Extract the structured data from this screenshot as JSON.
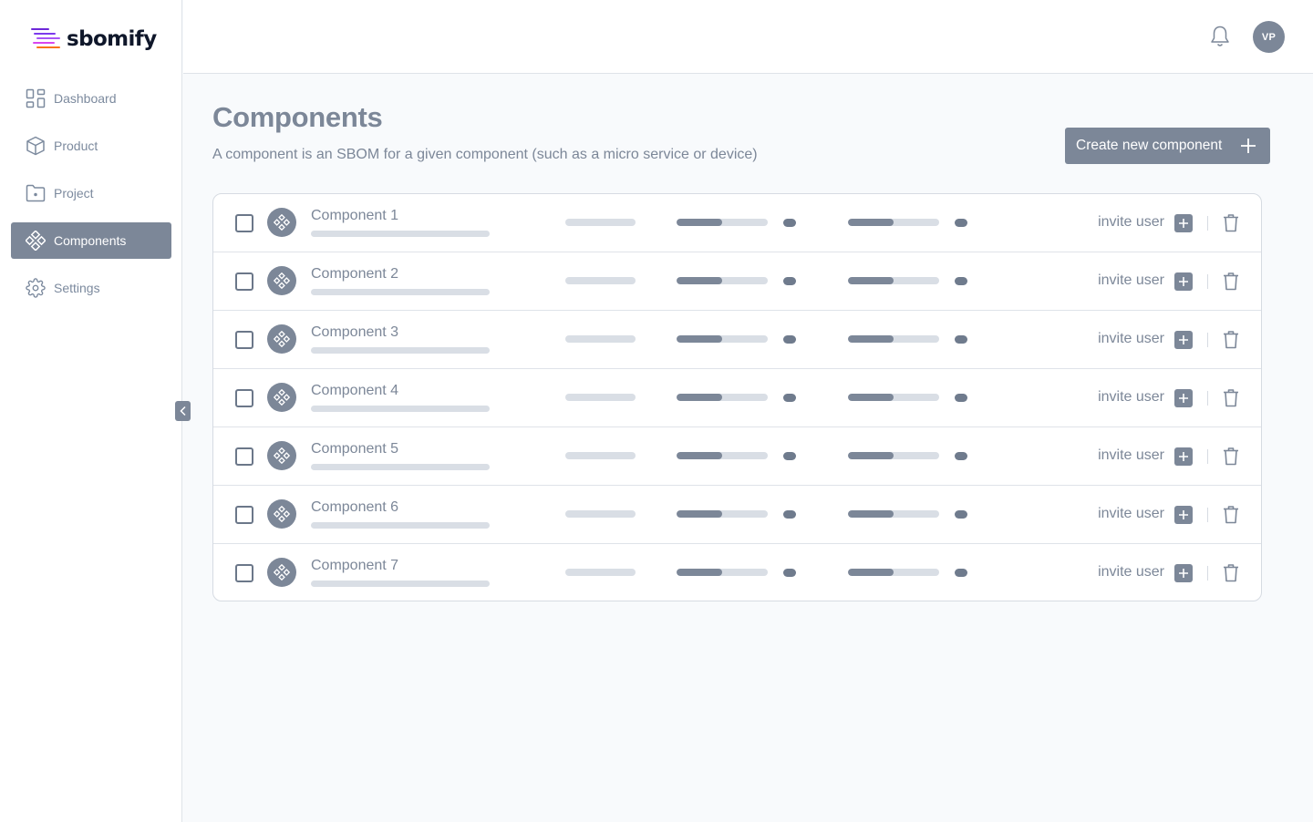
{
  "brand": {
    "name": "sbomify"
  },
  "sidebar": {
    "items": [
      {
        "label": "Dashboard",
        "icon": "dashboard-icon",
        "active": false
      },
      {
        "label": "Product",
        "icon": "cube-icon",
        "active": false
      },
      {
        "label": "Project",
        "icon": "folder-icon",
        "active": false
      },
      {
        "label": "Components",
        "icon": "components-icon",
        "active": true
      },
      {
        "label": "Settings",
        "icon": "gear-icon",
        "active": false
      }
    ]
  },
  "header": {
    "avatar_initials": "VP",
    "notifications_icon": "bell-icon"
  },
  "main": {
    "title": "Components",
    "subtitle": "A component is an SBOM for a given component (such as a micro service or device)",
    "create_button_label": "Create new component"
  },
  "table": {
    "invite_label": "invite user",
    "rows": [
      {
        "name": "Component 1",
        "progress_a": 0.5,
        "progress_b": 0.5
      },
      {
        "name": "Component 2",
        "progress_a": 0.5,
        "progress_b": 0.5
      },
      {
        "name": "Component 3",
        "progress_a": 0.5,
        "progress_b": 0.5
      },
      {
        "name": "Component 4",
        "progress_a": 0.5,
        "progress_b": 0.5
      },
      {
        "name": "Component 5",
        "progress_a": 0.5,
        "progress_b": 0.5
      },
      {
        "name": "Component 6",
        "progress_a": 0.5,
        "progress_b": 0.5
      },
      {
        "name": "Component 7",
        "progress_a": 0.5,
        "progress_b": 0.5
      }
    ]
  },
  "colors": {
    "accent": "#7c8798",
    "placeholder": "#d9dee5",
    "logo_gradient": [
      "#4f46e5",
      "#c026d3",
      "#f97316"
    ]
  }
}
